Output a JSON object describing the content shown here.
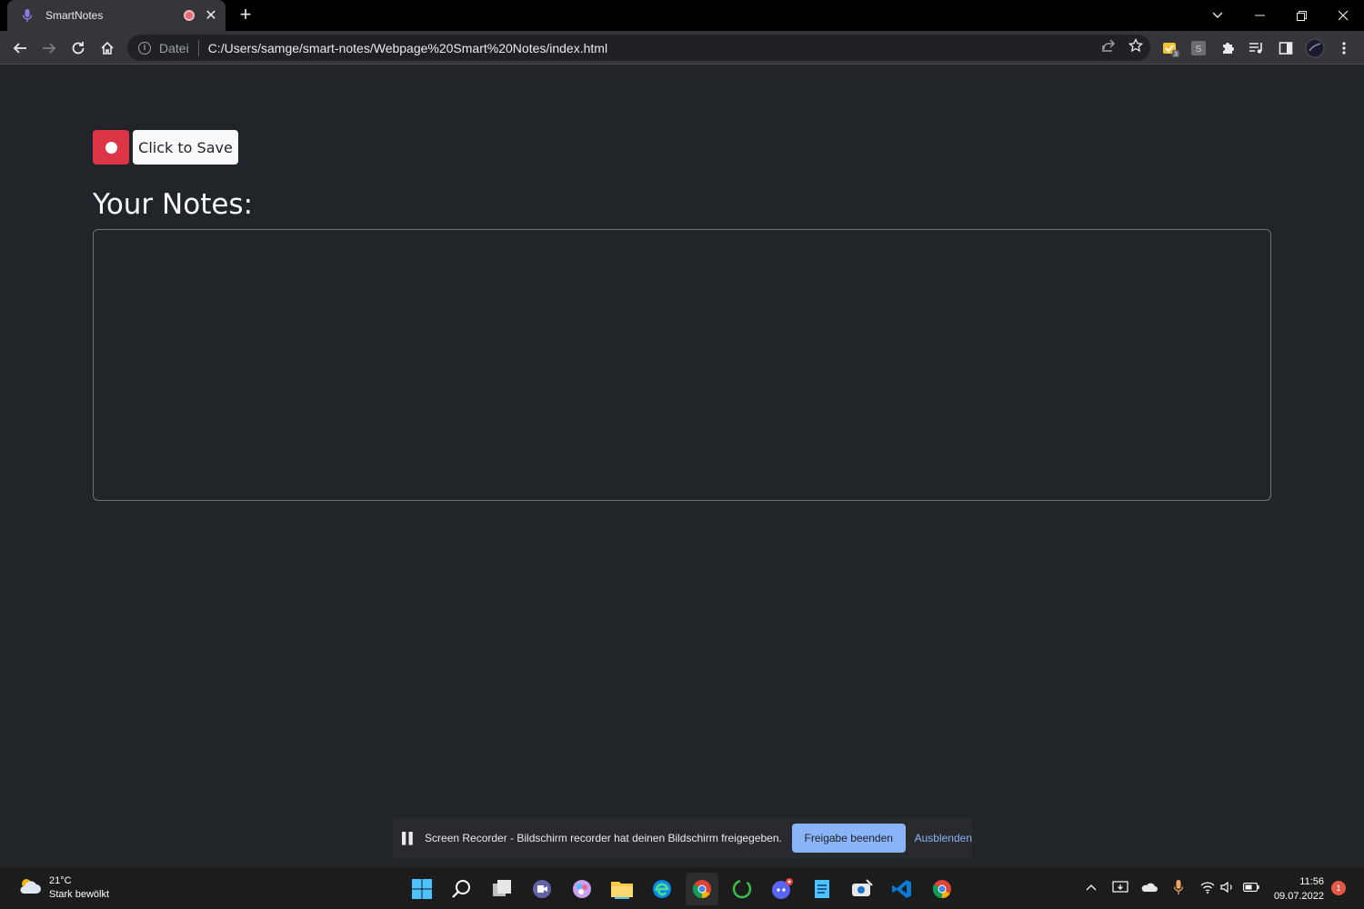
{
  "browser": {
    "tab_title": "SmartNotes",
    "address_scheme_label": "Datei",
    "url": "C:/Users/samge/smart-notes/Webpage%20Smart%20Notes/index.html"
  },
  "page": {
    "save_button_label": "Click to Save",
    "notes_heading": "Your Notes:",
    "notes_value": ""
  },
  "share_bar": {
    "message": "Screen Recorder - Bildschirm recorder hat deinen Bildschirm freigegeben.",
    "stop_button": "Freigabe beenden",
    "hide_link": "Ausblenden"
  },
  "taskbar": {
    "weather_temp": "21°C",
    "weather_desc": "Stark bewölkt",
    "time": "11:56",
    "date": "09.07.2022",
    "notification_count": "1"
  },
  "colors": {
    "record_button": "#dc3545",
    "page_background": "#212529",
    "accent_blue": "#8ab4f8"
  }
}
